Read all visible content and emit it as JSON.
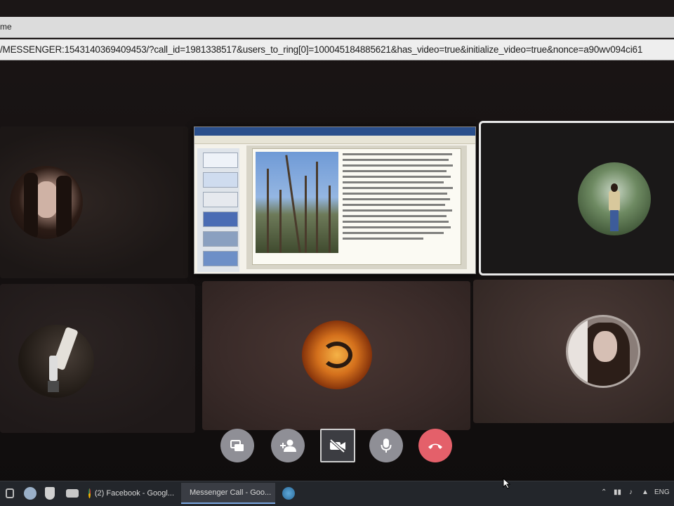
{
  "window": {
    "title": "me",
    "url": "/MESSENGER:1543140369409453/?call_id=1981338517&users_to_ring[0]=100045184885621&has_video=true&initialize_video=true&nonce=a90wv094ci61"
  },
  "call": {
    "participants": [
      {
        "name": "participant-1",
        "avatar_colors": [
          "#b8a69a",
          "#2a1a14"
        ]
      },
      {
        "name": "shared-screen"
      },
      {
        "name": "participant-2",
        "avatar_colors": [
          "#5d7a50",
          "#c8d0c0"
        ]
      },
      {
        "name": "participant-3",
        "avatar_colors": [
          "#2a2420",
          "#d9d4ce"
        ]
      },
      {
        "name": "participant-4",
        "avatar_colors": [
          "#e0a040",
          "#3a1c0a"
        ]
      },
      {
        "name": "participant-5",
        "avatar_colors": [
          "#d8cfcc",
          "#3a2a22"
        ]
      }
    ],
    "controls": [
      {
        "icon": "screen-share-icon",
        "color": "#8f8f96"
      },
      {
        "icon": "add-person-icon",
        "color": "#8f8f96"
      },
      {
        "icon": "video-off-icon",
        "color": "#3c3d42"
      },
      {
        "icon": "microphone-icon",
        "color": "#8f8f96"
      },
      {
        "icon": "end-call-icon",
        "color": "#e4606a"
      }
    ]
  },
  "taskbar": {
    "tasks": [
      {
        "label": "(2) Facebook - Googl...",
        "icon": "chrome-icon"
      },
      {
        "label": "Messenger Call - Goo...",
        "icon": "messenger-icon"
      }
    ],
    "language": "ENG"
  },
  "colors": {
    "accent": "#7aa6e0",
    "end_call": "#e4606a"
  }
}
